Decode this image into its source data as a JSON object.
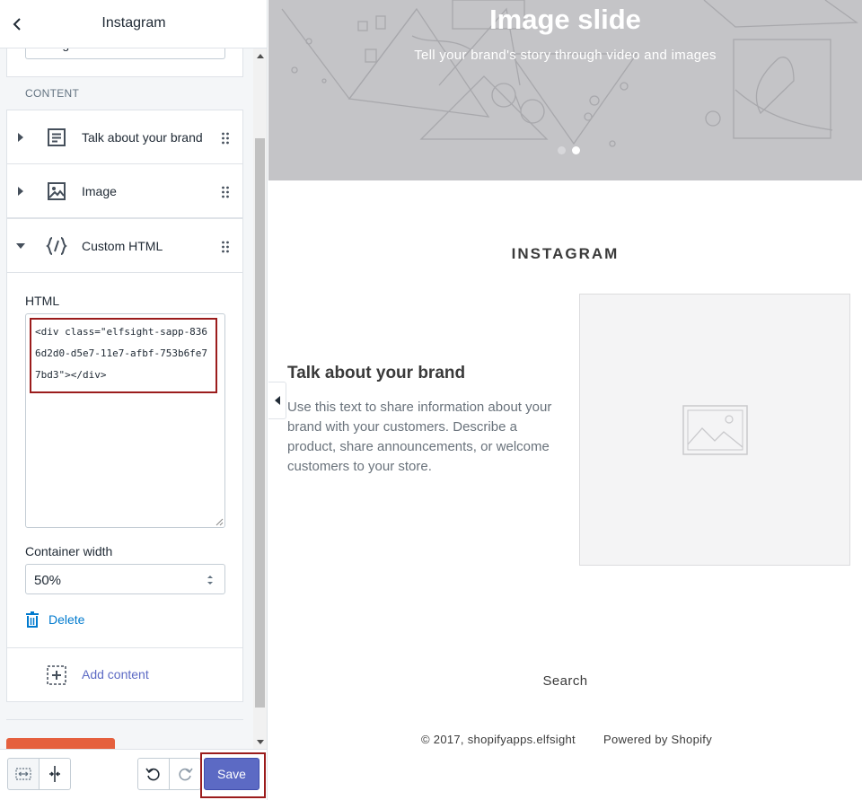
{
  "sidebar": {
    "title": "Instagram",
    "section_name_value": "Instagram",
    "content_label": "CONTENT",
    "blocks": [
      {
        "label": "Talk about your brand",
        "icon": "text-block-icon"
      },
      {
        "label": "Image",
        "icon": "image-icon"
      },
      {
        "label": "Custom HTML",
        "icon": "code-icon"
      }
    ],
    "custom_html": {
      "label": "HTML",
      "code": "<div class=\"elfsight-sapp-8366d2d0-d5e7-11e7-afbf-753b6fe77bd3\"></div>",
      "container_width_label": "Container width",
      "container_width_value": "50%",
      "delete_label": "Delete"
    },
    "add_content_label": "Add content",
    "footer": {
      "save_label": "Save"
    }
  },
  "preview": {
    "hero": {
      "title": "Image slide",
      "subtitle": "Tell your brand's story through video and images"
    },
    "section_title": "INSTAGRAM",
    "brand_heading": "Talk about your brand",
    "brand_text": "Use this text to share information about your brand with your customers. Describe a product, share announcements, or welcome customers to your store.",
    "footer": {
      "search": "Search",
      "copyright": "© 2017, shopifyapps.elfsight",
      "powered_by": "Powered by Shopify"
    }
  },
  "colors": {
    "primary": "#5c6ac4",
    "link": "#007ace",
    "highlight": "#9b1c1c",
    "danger": "#e5603e"
  }
}
